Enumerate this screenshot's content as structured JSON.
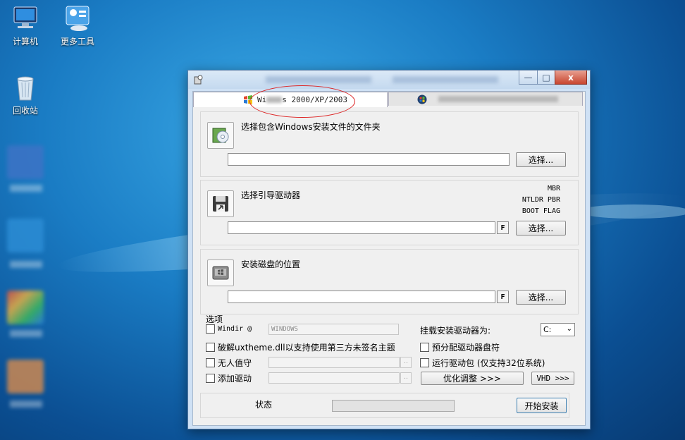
{
  "desktop": {
    "icons": [
      {
        "label": "计算机",
        "icon": "computer-icon"
      },
      {
        "label": "更多工具",
        "icon": "tools-icon"
      },
      {
        "label": "回收站",
        "icon": "recycle-bin-icon"
      }
    ]
  },
  "window": {
    "buttons": {
      "minimize": "—",
      "maximize": "□",
      "close": "x"
    },
    "tabs": [
      {
        "label_prefix": "Wi",
        "label_suffix": "s 2000/XP/2003",
        "icon": "windows-xp-icon",
        "active": true
      },
      {
        "label_prefix": "",
        "icon": "windows-vista-icon",
        "active": false
      }
    ],
    "section1": {
      "label": "选择包含Windows安装文件的文件夹",
      "path_value": "",
      "button": "选择..."
    },
    "section2": {
      "label": "选择引导驱动器",
      "flags": [
        "MBR",
        "NTLDR PBR",
        "BOOT FLAG"
      ],
      "path_value": "",
      "f_button": "F",
      "button": "选择..."
    },
    "section3": {
      "label": "安装磁盘的位置",
      "path_value": "",
      "f_button": "F",
      "button": "选择..."
    },
    "options": {
      "title": "选项",
      "windir_label": "Windir @",
      "windir_value": "WINDOWS",
      "uxtheme_label": "破解uxtheme.dll以支持使用第三方未签名主题",
      "unattended_label": "无人值守",
      "add_driver_label": "添加驱动",
      "browse_dots": "..",
      "mount_label": "挂载安装驱动器为:",
      "mount_value": "C:",
      "prealloc_label": "预分配驱动器盘符",
      "run_driver_label": "运行驱动包 (仅支持32位系统)",
      "optimize_button": "优化调整 >>>",
      "vhd_button": "VHD >>>"
    },
    "status": {
      "label": "状态",
      "progress": 0,
      "start_button": "开始安装"
    }
  }
}
